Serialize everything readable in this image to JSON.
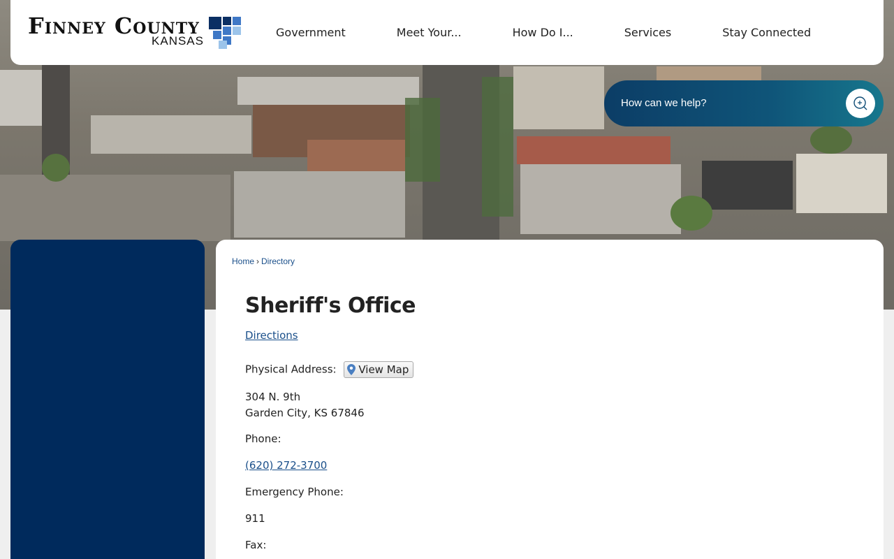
{
  "header": {
    "logo_title": "Finney County",
    "logo_subtitle": "KANSAS",
    "nav": [
      "Government",
      "Meet Your...",
      "How Do I...",
      "Services",
      "Stay Connected"
    ]
  },
  "search": {
    "placeholder": "How can we help?"
  },
  "breadcrumb": {
    "home": "Home",
    "separator": "›",
    "current": "Directory"
  },
  "page": {
    "title": "Sheriff's Office",
    "directions_link": "Directions",
    "physical_address_label": "Physical Address:",
    "view_map_label": "View Map",
    "address_line1": "304 N. 9th",
    "address_line2": "Garden City, KS 67846",
    "phone_label": "Phone:",
    "phone_value": "(620) 272-3700",
    "emergency_label": "Emergency Phone:",
    "emergency_value": "911",
    "fax_label": "Fax:"
  },
  "colors": {
    "sidebar": "#002a5c",
    "search_gradient_start": "#0c3d66",
    "search_gradient_end": "#17778d",
    "link": "#1a4f8a",
    "logo_dark_blue": "#0b2f63",
    "logo_mid_blue": "#3f78c6",
    "logo_light_blue": "#9cc4ea"
  },
  "icons": {
    "search": "search-icon",
    "map_pin": "map-pin-icon",
    "logo": "logo-squares-icon"
  }
}
